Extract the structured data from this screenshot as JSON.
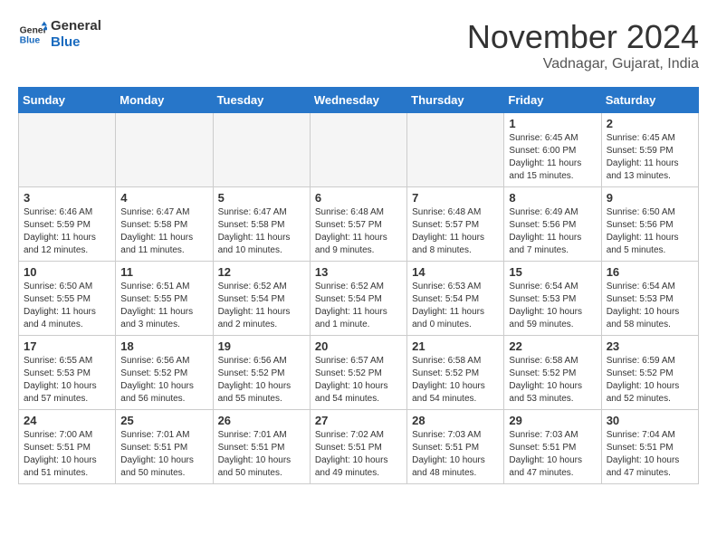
{
  "header": {
    "logo_line1": "General",
    "logo_line2": "Blue",
    "month_title": "November 2024",
    "location": "Vadnagar, Gujarat, India"
  },
  "weekdays": [
    "Sunday",
    "Monday",
    "Tuesday",
    "Wednesday",
    "Thursday",
    "Friday",
    "Saturday"
  ],
  "weeks": [
    [
      {
        "day": "",
        "empty": true
      },
      {
        "day": "",
        "empty": true
      },
      {
        "day": "",
        "empty": true
      },
      {
        "day": "",
        "empty": true
      },
      {
        "day": "",
        "empty": true
      },
      {
        "day": "1",
        "sunrise": "6:45 AM",
        "sunset": "6:00 PM",
        "daylight": "11 hours and 15 minutes."
      },
      {
        "day": "2",
        "sunrise": "6:45 AM",
        "sunset": "5:59 PM",
        "daylight": "11 hours and 13 minutes."
      }
    ],
    [
      {
        "day": "3",
        "sunrise": "6:46 AM",
        "sunset": "5:59 PM",
        "daylight": "11 hours and 12 minutes."
      },
      {
        "day": "4",
        "sunrise": "6:47 AM",
        "sunset": "5:58 PM",
        "daylight": "11 hours and 11 minutes."
      },
      {
        "day": "5",
        "sunrise": "6:47 AM",
        "sunset": "5:58 PM",
        "daylight": "11 hours and 10 minutes."
      },
      {
        "day": "6",
        "sunrise": "6:48 AM",
        "sunset": "5:57 PM",
        "daylight": "11 hours and 9 minutes."
      },
      {
        "day": "7",
        "sunrise": "6:48 AM",
        "sunset": "5:57 PM",
        "daylight": "11 hours and 8 minutes."
      },
      {
        "day": "8",
        "sunrise": "6:49 AM",
        "sunset": "5:56 PM",
        "daylight": "11 hours and 7 minutes."
      },
      {
        "day": "9",
        "sunrise": "6:50 AM",
        "sunset": "5:56 PM",
        "daylight": "11 hours and 5 minutes."
      }
    ],
    [
      {
        "day": "10",
        "sunrise": "6:50 AM",
        "sunset": "5:55 PM",
        "daylight": "11 hours and 4 minutes."
      },
      {
        "day": "11",
        "sunrise": "6:51 AM",
        "sunset": "5:55 PM",
        "daylight": "11 hours and 3 minutes."
      },
      {
        "day": "12",
        "sunrise": "6:52 AM",
        "sunset": "5:54 PM",
        "daylight": "11 hours and 2 minutes."
      },
      {
        "day": "13",
        "sunrise": "6:52 AM",
        "sunset": "5:54 PM",
        "daylight": "11 hours and 1 minute."
      },
      {
        "day": "14",
        "sunrise": "6:53 AM",
        "sunset": "5:54 PM",
        "daylight": "11 hours and 0 minutes."
      },
      {
        "day": "15",
        "sunrise": "6:54 AM",
        "sunset": "5:53 PM",
        "daylight": "10 hours and 59 minutes."
      },
      {
        "day": "16",
        "sunrise": "6:54 AM",
        "sunset": "5:53 PM",
        "daylight": "10 hours and 58 minutes."
      }
    ],
    [
      {
        "day": "17",
        "sunrise": "6:55 AM",
        "sunset": "5:53 PM",
        "daylight": "10 hours and 57 minutes."
      },
      {
        "day": "18",
        "sunrise": "6:56 AM",
        "sunset": "5:52 PM",
        "daylight": "10 hours and 56 minutes."
      },
      {
        "day": "19",
        "sunrise": "6:56 AM",
        "sunset": "5:52 PM",
        "daylight": "10 hours and 55 minutes."
      },
      {
        "day": "20",
        "sunrise": "6:57 AM",
        "sunset": "5:52 PM",
        "daylight": "10 hours and 54 minutes."
      },
      {
        "day": "21",
        "sunrise": "6:58 AM",
        "sunset": "5:52 PM",
        "daylight": "10 hours and 54 minutes."
      },
      {
        "day": "22",
        "sunrise": "6:58 AM",
        "sunset": "5:52 PM",
        "daylight": "10 hours and 53 minutes."
      },
      {
        "day": "23",
        "sunrise": "6:59 AM",
        "sunset": "5:52 PM",
        "daylight": "10 hours and 52 minutes."
      }
    ],
    [
      {
        "day": "24",
        "sunrise": "7:00 AM",
        "sunset": "5:51 PM",
        "daylight": "10 hours and 51 minutes."
      },
      {
        "day": "25",
        "sunrise": "7:01 AM",
        "sunset": "5:51 PM",
        "daylight": "10 hours and 50 minutes."
      },
      {
        "day": "26",
        "sunrise": "7:01 AM",
        "sunset": "5:51 PM",
        "daylight": "10 hours and 50 minutes."
      },
      {
        "day": "27",
        "sunrise": "7:02 AM",
        "sunset": "5:51 PM",
        "daylight": "10 hours and 49 minutes."
      },
      {
        "day": "28",
        "sunrise": "7:03 AM",
        "sunset": "5:51 PM",
        "daylight": "10 hours and 48 minutes."
      },
      {
        "day": "29",
        "sunrise": "7:03 AM",
        "sunset": "5:51 PM",
        "daylight": "10 hours and 47 minutes."
      },
      {
        "day": "30",
        "sunrise": "7:04 AM",
        "sunset": "5:51 PM",
        "daylight": "10 hours and 47 minutes."
      }
    ]
  ]
}
